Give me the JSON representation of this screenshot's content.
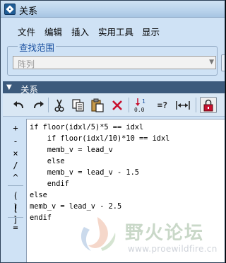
{
  "window": {
    "title": "关系"
  },
  "menu": [
    {
      "label": "文件"
    },
    {
      "label": "编辑"
    },
    {
      "label": "插入"
    },
    {
      "label": "实用工具"
    },
    {
      "label": "显示"
    }
  ],
  "search": {
    "group_title": "查找范围",
    "value": "阵列"
  },
  "section": {
    "title": "关系"
  },
  "toolbar": {
    "buttons": [
      {
        "icon": "undo-icon"
      },
      {
        "icon": "redo-icon"
      },
      {
        "icon": "cut-icon"
      },
      {
        "icon": "copy-icon"
      },
      {
        "icon": "paste-icon"
      },
      {
        "icon": "delete-icon"
      },
      {
        "icon": "sort-relations-icon"
      },
      {
        "icon": "evaluate-icon",
        "label": "=?"
      },
      {
        "icon": "measure-icon"
      },
      {
        "icon": "lock-parameter-icon"
      }
    ],
    "sort_icon_digits": [
      "1",
      "0.0"
    ]
  },
  "operators": [
    {
      "symbol": "+"
    },
    {
      "symbol": "-"
    },
    {
      "symbol": "×"
    },
    {
      "symbol": "/"
    },
    {
      "symbol": "^"
    },
    {
      "symbol": "( )"
    },
    {
      "symbol": "[ ]"
    },
    {
      "symbol": "="
    }
  ],
  "editor": {
    "lines": [
      "if floor(idxl/5)*5 == idxl",
      "    if floor(idxl/10)*10 == idxl",
      "    memb_v = lead_v",
      "    else",
      "    memb_v = lead_v - 1.5",
      "    endif",
      "else",
      "memb_v = lead_v - 2.5",
      "endif"
    ]
  },
  "watermark": {
    "text": "野火论坛",
    "url": "www.proewildfire.cn"
  },
  "colors": {
    "frame": "#cfe2f5",
    "section_header": "#3c5a7c",
    "group_title": "#1a50a0"
  }
}
